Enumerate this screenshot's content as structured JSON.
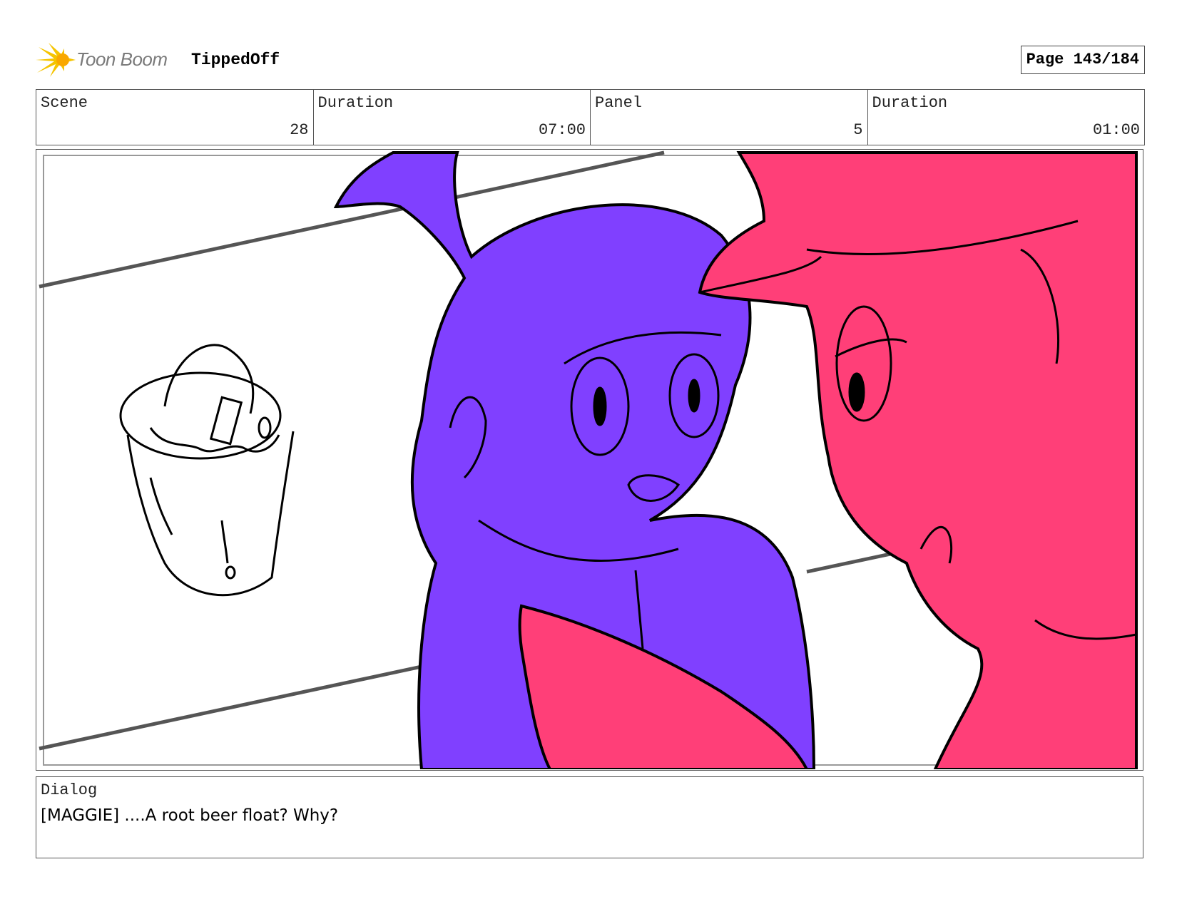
{
  "header": {
    "logo_text": "Toon Boom",
    "project_title": "TippedOff",
    "page_label": "Page 143/184"
  },
  "info": {
    "scene_label": "Scene",
    "scene_value": "28",
    "scene_duration_label": "Duration",
    "scene_duration_value": "07:00",
    "panel_label": "Panel",
    "panel_value": "5",
    "panel_duration_label": "Duration",
    "panel_duration_value": "01:00"
  },
  "colors": {
    "character_left": "#8040ff",
    "character_right": "#ff3f78",
    "logo_accent": "#f5c400"
  },
  "dialog": {
    "label": "Dialog",
    "text": "[MAGGIE] ....A root beer float? Why?"
  }
}
